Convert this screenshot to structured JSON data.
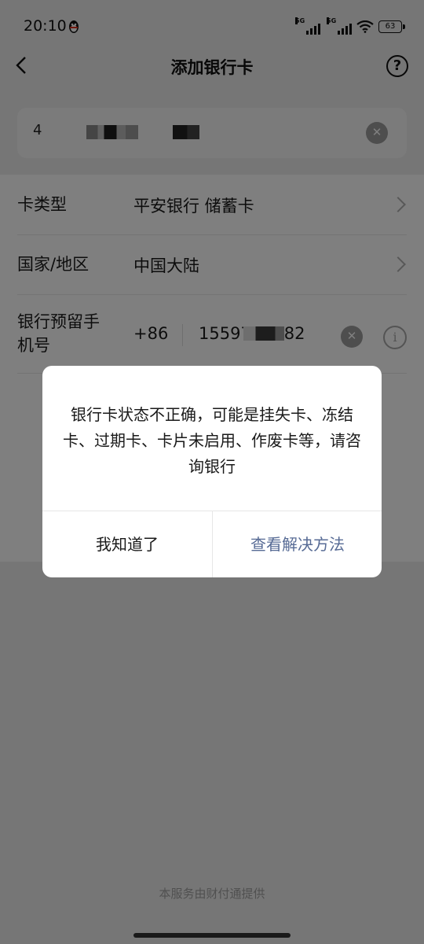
{
  "status_bar": {
    "time": "20:10",
    "network_tag_1": "5G",
    "network_tag_2": "5G",
    "battery": "63",
    "icons": [
      "qq-icon",
      "signal-icon",
      "signal-icon",
      "wifi-icon",
      "battery-icon"
    ]
  },
  "nav": {
    "title": "添加银行卡",
    "back_icon": "chevron-left-icon",
    "help_icon": "question-circle-icon",
    "help_glyph": "?"
  },
  "card_number": {
    "visible_prefix": "4",
    "clear_glyph": "✕"
  },
  "form": {
    "card_type_label": "卡类型",
    "card_type_value": "平安银行 储蓄卡",
    "region_label": "国家/地区",
    "region_value": "中国大陆",
    "phone_label": "银行预留手机号",
    "phone_country_code": "+86",
    "phone_value": "15597    82",
    "clear_glyph": "✕",
    "info_glyph": "i"
  },
  "dialog": {
    "message": "银行卡状态不正确，可能是挂失卡、冻结卡、过期卡、卡片未启用、作废卡等，请咨询银行",
    "ok_label": "我知道了",
    "solution_label": "查看解决方法",
    "accent_color": "#576b95"
  },
  "footer": {
    "provider_text": "本服务由财付通提供"
  }
}
